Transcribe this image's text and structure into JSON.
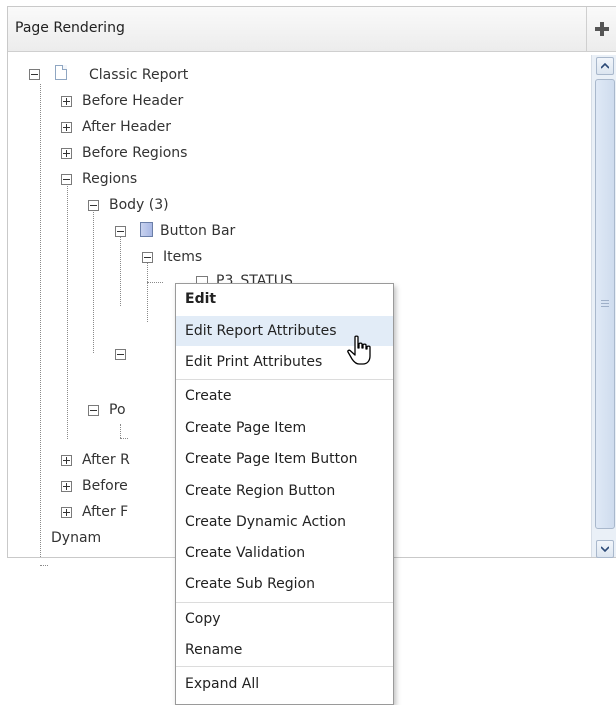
{
  "panel": {
    "title": "Page Rendering",
    "add_icon": "plus-icon"
  },
  "tree": {
    "root": "Classic Report",
    "before_header": "Before Header",
    "after_header": "After Header",
    "before_regions": "Before Regions",
    "regions": "Regions",
    "body": "Body (3)",
    "button_bar": "Button Bar",
    "items": "Items",
    "p3_status": "P3_STATUS",
    "partial_po": "Po",
    "partial_after_r": "After R",
    "partial_before": "Before",
    "partial_after_f": "After F",
    "partial_dynam": "Dynam"
  },
  "context_menu": {
    "items": [
      {
        "label": "Edit"
      },
      {
        "label": "Edit Report Attributes"
      },
      {
        "label": "Edit Print Attributes"
      },
      {
        "label": "Create"
      },
      {
        "label": "Create Page Item"
      },
      {
        "label": "Create Page Item Button"
      },
      {
        "label": "Create Region Button"
      },
      {
        "label": "Create Dynamic Action"
      },
      {
        "label": "Create Validation"
      },
      {
        "label": "Create Sub Region"
      },
      {
        "label": "Copy"
      },
      {
        "label": "Rename"
      },
      {
        "label": "Expand All"
      }
    ],
    "hovered": "Edit Report Attributes"
  },
  "colors": {
    "hover_bg": "#e2ecf7",
    "scrollbar_bg": "#eaf0f7",
    "region_icon": "#a8b7e4"
  },
  "icons": {
    "cursor": "hand-pointer-icon",
    "scroll_up": "chevron-up-icon",
    "scroll_down": "chevron-down-icon"
  }
}
